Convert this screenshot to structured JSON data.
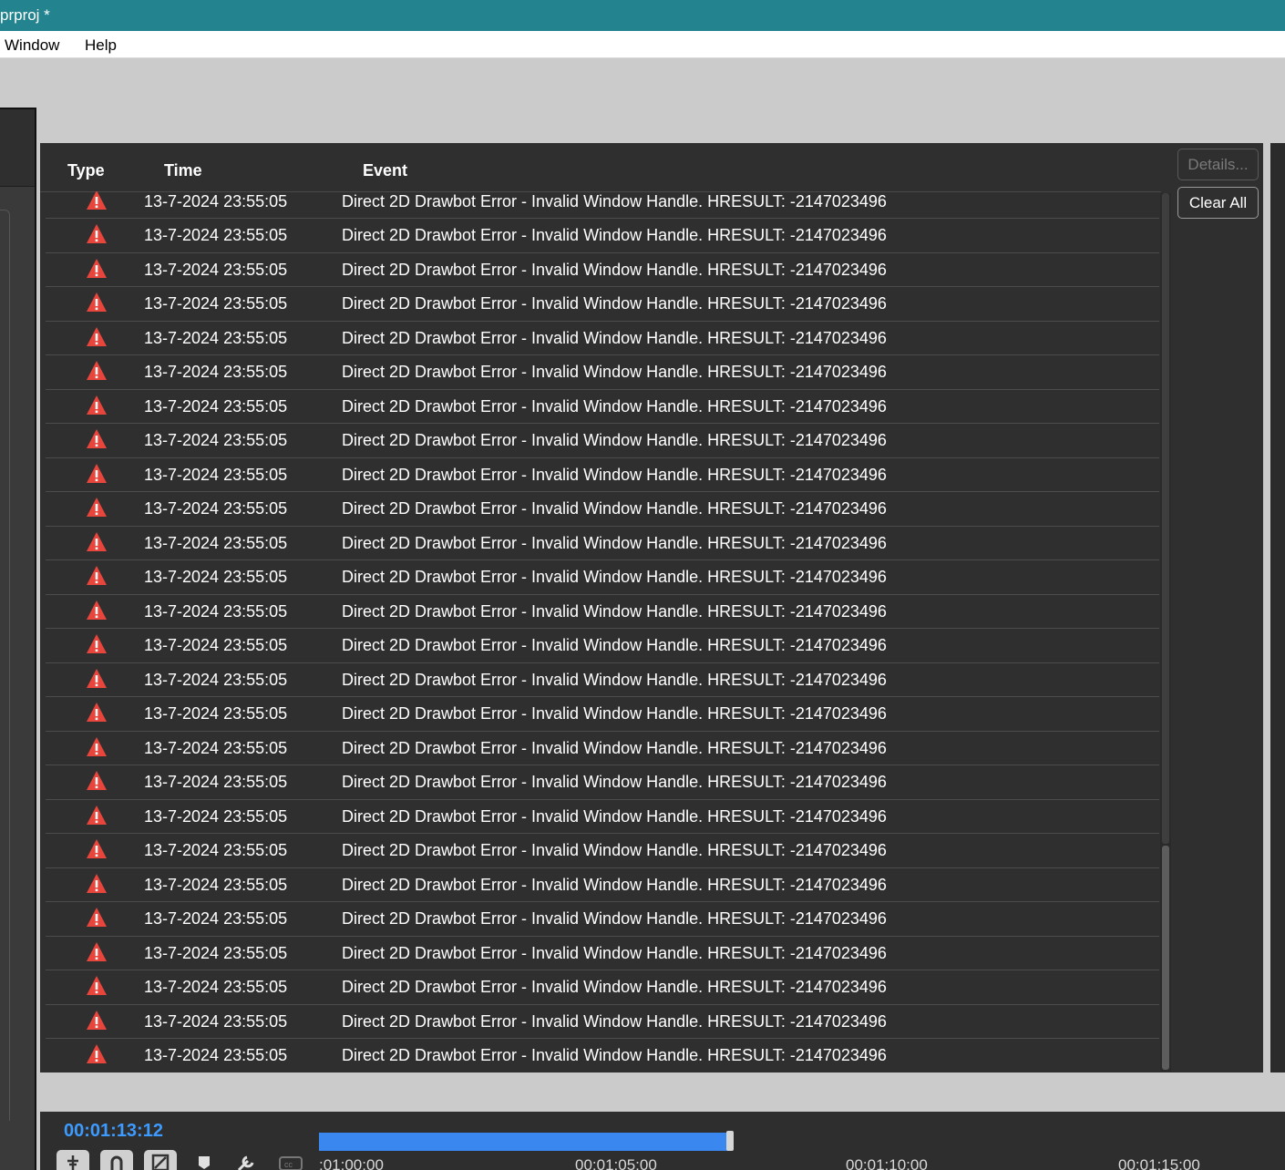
{
  "window": {
    "title": "prproj *"
  },
  "menu": [
    "Window",
    "Help"
  ],
  "events_panel": {
    "columns": {
      "type": "Type",
      "time": "Time",
      "event": "Event"
    },
    "buttons": {
      "details": "Details...",
      "clear_all": "Clear All"
    },
    "rows": [
      {
        "type": "warning-icon",
        "time": "13-7-2024 23:55:05",
        "event": "Direct 2D Drawbot Error - Invalid Window Handle. HRESULT: -2147023496"
      },
      {
        "type": "warning-icon",
        "time": "13-7-2024 23:55:05",
        "event": "Direct 2D Drawbot Error - Invalid Window Handle. HRESULT: -2147023496"
      },
      {
        "type": "warning-icon",
        "time": "13-7-2024 23:55:05",
        "event": "Direct 2D Drawbot Error - Invalid Window Handle. HRESULT: -2147023496"
      },
      {
        "type": "warning-icon",
        "time": "13-7-2024 23:55:05",
        "event": "Direct 2D Drawbot Error - Invalid Window Handle. HRESULT: -2147023496"
      },
      {
        "type": "warning-icon",
        "time": "13-7-2024 23:55:05",
        "event": "Direct 2D Drawbot Error - Invalid Window Handle. HRESULT: -2147023496"
      },
      {
        "type": "warning-icon",
        "time": "13-7-2024 23:55:05",
        "event": "Direct 2D Drawbot Error - Invalid Window Handle. HRESULT: -2147023496"
      },
      {
        "type": "warning-icon",
        "time": "13-7-2024 23:55:05",
        "event": "Direct 2D Drawbot Error - Invalid Window Handle. HRESULT: -2147023496"
      },
      {
        "type": "warning-icon",
        "time": "13-7-2024 23:55:05",
        "event": "Direct 2D Drawbot Error - Invalid Window Handle. HRESULT: -2147023496"
      },
      {
        "type": "warning-icon",
        "time": "13-7-2024 23:55:05",
        "event": "Direct 2D Drawbot Error - Invalid Window Handle. HRESULT: -2147023496"
      },
      {
        "type": "warning-icon",
        "time": "13-7-2024 23:55:05",
        "event": "Direct 2D Drawbot Error - Invalid Window Handle. HRESULT: -2147023496"
      },
      {
        "type": "warning-icon",
        "time": "13-7-2024 23:55:05",
        "event": "Direct 2D Drawbot Error - Invalid Window Handle. HRESULT: -2147023496"
      },
      {
        "type": "warning-icon",
        "time": "13-7-2024 23:55:05",
        "event": "Direct 2D Drawbot Error - Invalid Window Handle. HRESULT: -2147023496"
      },
      {
        "type": "warning-icon",
        "time": "13-7-2024 23:55:05",
        "event": "Direct 2D Drawbot Error - Invalid Window Handle. HRESULT: -2147023496"
      },
      {
        "type": "warning-icon",
        "time": "13-7-2024 23:55:05",
        "event": "Direct 2D Drawbot Error - Invalid Window Handle. HRESULT: -2147023496"
      },
      {
        "type": "warning-icon",
        "time": "13-7-2024 23:55:05",
        "event": "Direct 2D Drawbot Error - Invalid Window Handle. HRESULT: -2147023496"
      },
      {
        "type": "warning-icon",
        "time": "13-7-2024 23:55:05",
        "event": "Direct 2D Drawbot Error - Invalid Window Handle. HRESULT: -2147023496"
      },
      {
        "type": "warning-icon",
        "time": "13-7-2024 23:55:05",
        "event": "Direct 2D Drawbot Error - Invalid Window Handle. HRESULT: -2147023496"
      },
      {
        "type": "warning-icon",
        "time": "13-7-2024 23:55:05",
        "event": "Direct 2D Drawbot Error - Invalid Window Handle. HRESULT: -2147023496"
      },
      {
        "type": "warning-icon",
        "time": "13-7-2024 23:55:05",
        "event": "Direct 2D Drawbot Error - Invalid Window Handle. HRESULT: -2147023496"
      },
      {
        "type": "warning-icon",
        "time": "13-7-2024 23:55:05",
        "event": "Direct 2D Drawbot Error - Invalid Window Handle. HRESULT: -2147023496"
      },
      {
        "type": "warning-icon",
        "time": "13-7-2024 23:55:05",
        "event": "Direct 2D Drawbot Error - Invalid Window Handle. HRESULT: -2147023496"
      },
      {
        "type": "warning-icon",
        "time": "13-7-2024 23:55:05",
        "event": "Direct 2D Drawbot Error - Invalid Window Handle. HRESULT: -2147023496"
      },
      {
        "type": "warning-icon",
        "time": "13-7-2024 23:55:05",
        "event": "Direct 2D Drawbot Error - Invalid Window Handle. HRESULT: -2147023496"
      },
      {
        "type": "warning-icon",
        "time": "13-7-2024 23:55:05",
        "event": "Direct 2D Drawbot Error - Invalid Window Handle. HRESULT: -2147023496"
      },
      {
        "type": "warning-icon",
        "time": "13-7-2024 23:55:05",
        "event": "Direct 2D Drawbot Error - Invalid Window Handle. HRESULT: -2147023496"
      },
      {
        "type": "warning-icon",
        "time": "13-7-2024 23:55:05",
        "event": "Direct 2D Drawbot Error - Invalid Window Handle. HRESULT: -2147023496"
      }
    ]
  },
  "timeline": {
    "timecode": "00:01:13:12",
    "ruler": [
      ":01:00:00",
      "00:01:05:00",
      "00:01:10:00",
      "00:01:15:00"
    ]
  },
  "colors": {
    "titlebar": "#23848f",
    "panel_bg": "#2f2f2f",
    "warning": "#e8453c",
    "timecode": "#3d9bff",
    "work_area": "#3b87f0"
  }
}
